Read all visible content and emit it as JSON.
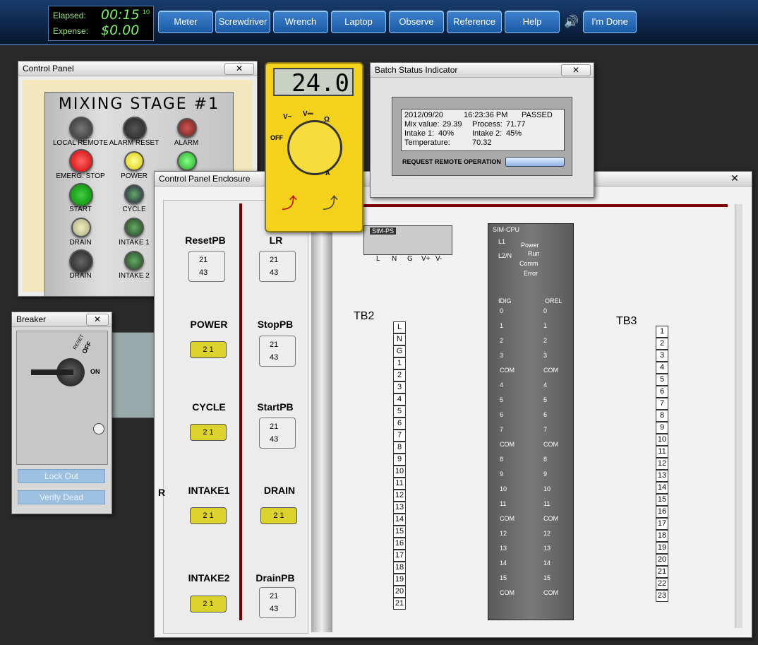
{
  "topbar": {
    "elapsed_label": "Elapsed:",
    "elapsed_value": "00:15",
    "elapsed_sup": "10",
    "expense_label": "Expense:",
    "expense_value": "$0.00",
    "tools": [
      "Meter",
      "Screwdriver",
      "Wrench",
      "Laptop",
      "Observe",
      "Reference",
      "Help"
    ],
    "done_label": "I'm Done",
    "sound_icon": "speaker-icon"
  },
  "control_panel": {
    "title": "Control Panel",
    "heading": "MIXING STAGE #1",
    "labels": [
      "LOCAL  REMOTE",
      "ALARM RESET",
      "ALARM",
      "EMERG. STOP",
      "POWER",
      "START",
      "CYCLE",
      "DRAIN",
      "INTAKE 1",
      "DRAIN",
      "INTAKE 2"
    ]
  },
  "meter": {
    "display": "24.0",
    "dial_labels": [
      "V~",
      "V⎓",
      "Ω",
      "OFF",
      "A"
    ]
  },
  "batch": {
    "title": "Batch Status Indicator",
    "date": "2012/09/20",
    "time": "16:23:36 PM",
    "status": "PASSED",
    "mix_label": "Mix value:",
    "mix_value": "29.39",
    "process_label": "Process:",
    "process_value": "71.77",
    "intake1_label": "Intake 1:",
    "intake1_value": "40%",
    "intake2_label": "Intake 2:",
    "intake2_value": "45%",
    "temp_label": "Temperature:",
    "temp_value": "70.32",
    "request_label": "REQUEST REMOTE OPERATION"
  },
  "breaker": {
    "title": "Breaker",
    "reset_label": "RESET",
    "off_label": "OFF",
    "on_label": "ON",
    "lockout_label": "Lock Out",
    "verify_label": "Verify Dead"
  },
  "enclosure": {
    "title": "Control Panel Enclosure",
    "pushbuttons": [
      {
        "name": "ResetPB"
      },
      {
        "name": "LR"
      },
      {
        "name": "POWER"
      },
      {
        "name": "StopPB"
      },
      {
        "name": "CYCLE"
      },
      {
        "name": "StartPB"
      },
      {
        "name": "INTAKE1"
      },
      {
        "name": "DRAIN"
      },
      {
        "name": "INTAKE2"
      },
      {
        "name": "DrainPB"
      }
    ],
    "contact_top": "21",
    "contact_bottom": "43",
    "lamp_text": "2  1",
    "ps_label": "SIM-PS",
    "ps_terminals": [
      "L",
      "N",
      "G",
      "V+",
      "V-"
    ],
    "cpu_label": "SIM-CPU",
    "cpu_terminals": [
      "L1",
      "L2/N"
    ],
    "cpu_status": [
      "Power",
      "Run",
      "Comm",
      "Error"
    ],
    "idig_label": "IDIG",
    "orel_label": "OREL",
    "io_rows": [
      "0",
      "1",
      "2",
      "3",
      "COM",
      "4",
      "5",
      "6",
      "7",
      "COM",
      "8",
      "9",
      "10",
      "11",
      "COM",
      "12",
      "13",
      "14",
      "15",
      "COM"
    ],
    "tb2_label": "TB2",
    "tb2": [
      "L",
      "N",
      "G",
      "1",
      "2",
      "3",
      "4",
      "5",
      "6",
      "7",
      "8",
      "9",
      "10",
      "11",
      "12",
      "13",
      "14",
      "15",
      "16",
      "17",
      "18",
      "19",
      "20",
      "21"
    ],
    "tb3_label": "TB3",
    "tb3": [
      "1",
      "2",
      "3",
      "4",
      "5",
      "6",
      "7",
      "8",
      "9",
      "10",
      "11",
      "12",
      "13",
      "14",
      "15",
      "16",
      "17",
      "18",
      "19",
      "20",
      "21",
      "22",
      "23"
    ],
    "left_edge": "R"
  },
  "colors": {
    "wire_red": "#7b0000",
    "wire_green": "#1a8a1a",
    "meter_yellow": "#f4d21b",
    "accent_blue": "#2c6bb8"
  }
}
